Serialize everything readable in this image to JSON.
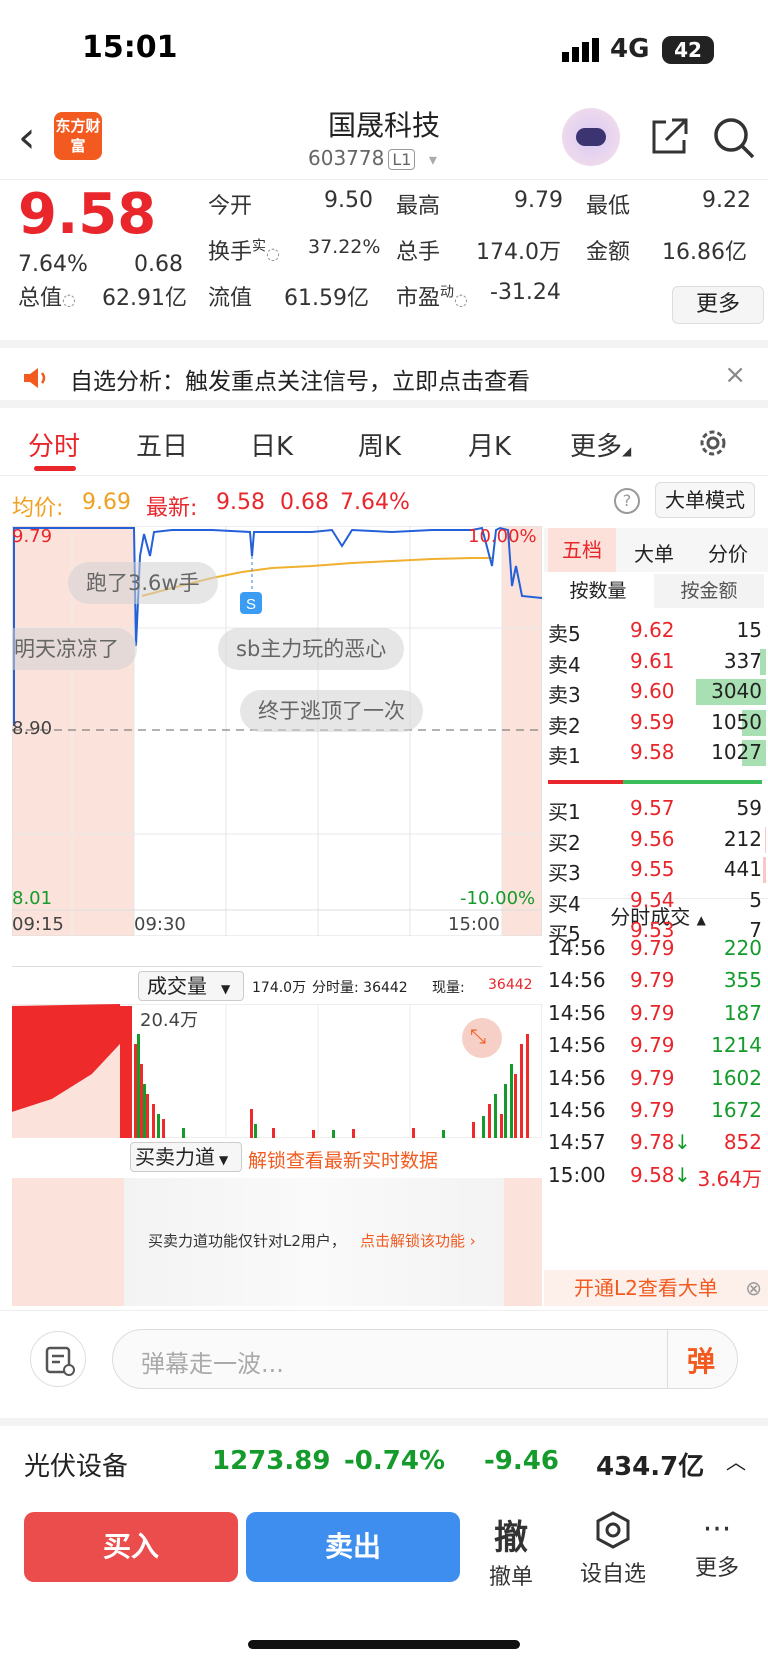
{
  "status": {
    "time": "15:01",
    "network": "4G",
    "battery": "42"
  },
  "header": {
    "back": "‹",
    "logo": "东方财富",
    "name": "国晟科技",
    "code": "603778",
    "level": "L1"
  },
  "quote": {
    "price": "9.58",
    "pct": "7.64%",
    "chg": "0.68",
    "open_label": "今开",
    "open": "9.50",
    "high_label": "最高",
    "high": "9.79",
    "low_label": "最低",
    "low": "9.22",
    "turnover_label": "换手",
    "turnover_sup": "实",
    "turnover": "37.22%",
    "vol_label": "总手",
    "vol": "174.0万",
    "amt_label": "金额",
    "amt": "16.86亿",
    "mcap_label": "总值",
    "mcap": "62.91亿",
    "float_label": "流值",
    "float": "61.59亿",
    "pe_label": "市盈",
    "pe_sup": "动",
    "pe": "-31.24",
    "more": "更多"
  },
  "banner": {
    "text": "自选分析：触发重点关注信号，立即点击查看",
    "close": "×"
  },
  "tabs": [
    "分时",
    "五日",
    "日K",
    "周K",
    "月K",
    "更多"
  ],
  "avg": {
    "avg_label": "均价:",
    "avg": "9.69",
    "last_label": "最新:",
    "last": "9.58",
    "chg": "0.68",
    "pct": "7.64%",
    "bigorder": "大单模式",
    "help": "?"
  },
  "chart": {
    "ymax": "9.79",
    "ymid": "8.90",
    "ymin": "8.01",
    "pmax": "10.00%",
    "pmin": "-10.00%",
    "t1": "09:15",
    "t2": "09:30",
    "t3": "15:00",
    "marker": "S",
    "comments": [
      "跑了3.6w手",
      "明天凉凉了",
      "sb主力玩的恶心",
      "终于逃顶了一次"
    ]
  },
  "volume": {
    "label": "成交量",
    "total": "174.0万",
    "fen": "分时量: 36442",
    "now_label": "现量:",
    "now": "36442",
    "max": "20.4万"
  },
  "power": {
    "label": "买卖力道",
    "link": "解锁查看最新实时数据",
    "notice": "买卖力道功能仅针对L2用户，",
    "unlock": "点击解锁该功能"
  },
  "orderbook": {
    "tabs": [
      "五档",
      "大单",
      "分价"
    ],
    "subtabs": [
      "按数量",
      "按金额"
    ],
    "asks": [
      {
        "l": "卖5",
        "p": "9.62",
        "v": "15",
        "r": 0
      },
      {
        "l": "卖4",
        "p": "9.61",
        "v": "337",
        "r": 0.08
      },
      {
        "l": "卖3",
        "p": "9.60",
        "v": "3040",
        "r": 1
      },
      {
        "l": "卖2",
        "p": "9.59",
        "v": "1050",
        "r": 0.35
      },
      {
        "l": "卖1",
        "p": "9.58",
        "v": "1027",
        "r": 0.34
      }
    ],
    "bids": [
      {
        "l": "买1",
        "p": "9.57",
        "v": "59",
        "r": 0
      },
      {
        "l": "买2",
        "p": "9.56",
        "v": "212",
        "r": 0.02
      },
      {
        "l": "买3",
        "p": "9.55",
        "v": "441",
        "r": 0.04
      },
      {
        "l": "买4",
        "p": "9.54",
        "v": "5",
        "r": 0
      },
      {
        "l": "买5",
        "p": "9.53",
        "v": "7",
        "r": 0
      }
    ],
    "trades_label": "分时成交",
    "trades": [
      {
        "t": "14:56",
        "p": "9.79",
        "v": "220",
        "a": ""
      },
      {
        "t": "14:56",
        "p": "9.79",
        "v": "355",
        "a": ""
      },
      {
        "t": "14:56",
        "p": "9.79",
        "v": "187",
        "a": ""
      },
      {
        "t": "14:56",
        "p": "9.79",
        "v": "1214",
        "a": ""
      },
      {
        "t": "14:56",
        "p": "9.79",
        "v": "1602",
        "a": ""
      },
      {
        "t": "14:56",
        "p": "9.79",
        "v": "1672",
        "a": ""
      },
      {
        "t": "14:57",
        "p": "9.78",
        "v": "852",
        "a": "↓"
      },
      {
        "t": "15:00",
        "p": "9.58",
        "v": "3.64万",
        "a": "↓"
      }
    ],
    "l2": "开通L2查看大单"
  },
  "danmu": {
    "placeholder": "弹幕走一波...",
    "btn": "弹"
  },
  "sector": {
    "name": "光伏设备",
    "index": "1273.89",
    "pct": "-0.74%",
    "chg": "-9.46",
    "amt": "434.7亿"
  },
  "bottom": {
    "buy": "买入",
    "sell": "卖出",
    "cancel_icon": "撤",
    "cancel": "撤单",
    "fav": "设自选",
    "more": "更多"
  },
  "colors": {
    "up": "#e8262b",
    "down": "#149b2c",
    "accent": "#f25a1f"
  }
}
